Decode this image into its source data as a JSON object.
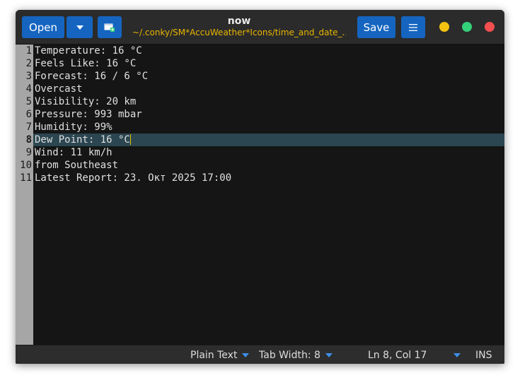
{
  "header": {
    "open_label": "Open",
    "title": "now",
    "path": "~/.conky/SM*AccuWeather*Icons/time_and_date_...",
    "save_label": "Save",
    "icons": {
      "dropdown": "chevron-down-icon",
      "new_tab": "new-document-icon",
      "menu": "hamburger-menu-icon"
    }
  },
  "window_controls": {
    "minimize_color": "#f5c211",
    "maximize_color": "#33d17a",
    "close_color": "#f44e4e"
  },
  "editor": {
    "current_line": 8,
    "lines": [
      {
        "num": "1",
        "text": "Temperature: 16 °C"
      },
      {
        "num": "2",
        "text": "Feels Like: 16 °C"
      },
      {
        "num": "3",
        "text": "Forecast: 16 / 6 °C"
      },
      {
        "num": "4",
        "text": "Overcast"
      },
      {
        "num": "5",
        "text": "Visibility: 20 km"
      },
      {
        "num": "6",
        "text": "Pressure: 993 mbar"
      },
      {
        "num": "7",
        "text": "Humidity: 99%"
      },
      {
        "num": "8",
        "text": "Dew Point: 16 °C"
      },
      {
        "num": "9",
        "text": "Wind: 11 km/h"
      },
      {
        "num": "10",
        "text": "from Southeast"
      },
      {
        "num": "11",
        "text": "Latest Report: 23. Окт 2025 17:00"
      }
    ]
  },
  "status": {
    "language": "Plain Text",
    "tab_width": "Tab Width: 8",
    "position": "Ln 8, Col 17",
    "mode": "INS"
  },
  "colors": {
    "accent": "#1565c0",
    "path_text": "#e8b600",
    "current_line_bg": "#2b4650",
    "gutter_bg": "#a6a6a6"
  }
}
